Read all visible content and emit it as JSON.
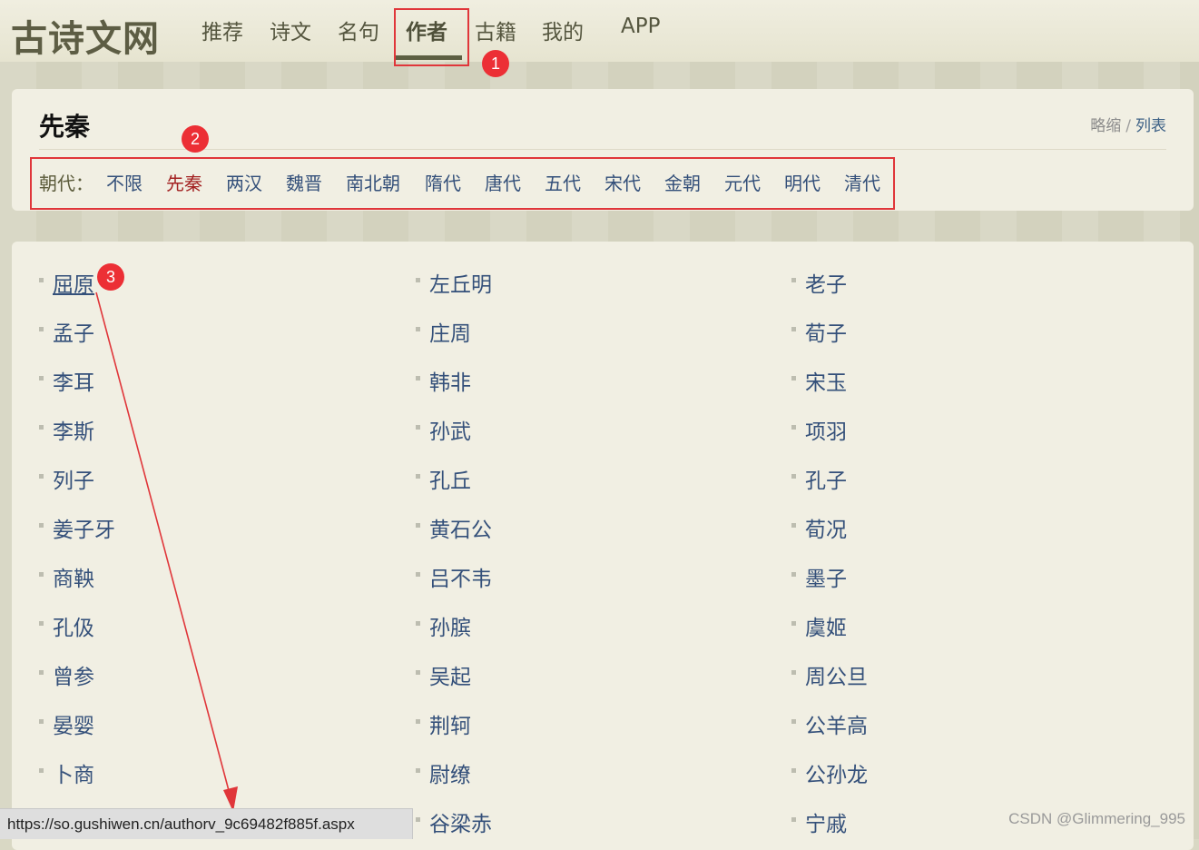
{
  "header": {
    "logo": "古诗文网",
    "nav": [
      {
        "label": "推荐"
      },
      {
        "label": "诗文"
      },
      {
        "label": "名句"
      },
      {
        "label": "作者"
      },
      {
        "label": "古籍"
      },
      {
        "label": "我的"
      },
      {
        "label": "APP"
      }
    ],
    "active_nav": "作者"
  },
  "filter": {
    "title": "先秦",
    "view_toggle": {
      "thumb": "略缩",
      "sep": "/",
      "list": "列表"
    },
    "dynasty_label": "朝代：",
    "dynasties": [
      "不限",
      "先秦",
      "两汉",
      "魏晋",
      "南北朝",
      "隋代",
      "唐代",
      "五代",
      "宋代",
      "金朝",
      "元代",
      "明代",
      "清代"
    ],
    "selected_dynasty": "先秦"
  },
  "authors": {
    "col1": [
      "屈原",
      "孟子",
      "李耳",
      "李斯",
      "列子",
      "姜子牙",
      "商鞅",
      "孔伋",
      "曾参",
      "晏婴",
      "卜商"
    ],
    "col2": [
      "左丘明",
      "庄周",
      "韩非",
      "孙武",
      "孔丘",
      "黄石公",
      "吕不韦",
      "孙膑",
      "吴起",
      "荆轲",
      "尉缭",
      "谷梁赤"
    ],
    "col3": [
      "老子",
      "荀子",
      "宋玉",
      "项羽",
      "孔子",
      "荀况",
      "墨子",
      "虞姬",
      "周公旦",
      "公羊高",
      "公孙龙",
      "宁戚"
    ]
  },
  "annotations": {
    "badge1": "1",
    "badge2": "2",
    "badge3": "3",
    "color": "#e0363a"
  },
  "status_url": "https://so.gushiwen.cn/authorv_9c69482f885f.aspx",
  "watermark": "CSDN @Glimmering_995",
  "colors": {
    "link": "#34507a",
    "selected": "#a32222",
    "panel": "#f1efe3",
    "page_bg": "#d7d6c2"
  }
}
